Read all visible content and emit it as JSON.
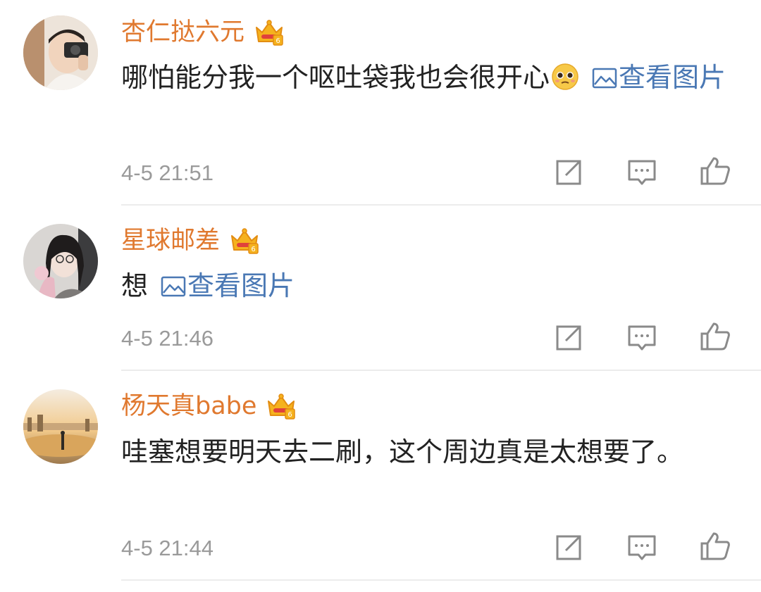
{
  "comments": [
    {
      "username": "杏仁挞六元",
      "text": "哪怕能分我一个呕吐袋我也会很开心",
      "link": "查看图片",
      "time": "4-5 21:51"
    },
    {
      "username": "星球邮差",
      "text": "想",
      "link": "查看图片",
      "time": "4-5 21:46"
    },
    {
      "username": "杨天真babe",
      "text": "哇塞想要明天去二刷，这个周边真是太想要了。",
      "link": "",
      "time": "4-5 21:44"
    }
  ],
  "colors": {
    "username": "#e0792f",
    "link": "#4a78b4",
    "timestamp": "#9a9a9a",
    "divider": "#ececec"
  },
  "icons": [
    "crown-badge-icon",
    "emoji-pleading-icon",
    "image-link-icon",
    "share-icon",
    "comment-icon",
    "like-icon"
  ]
}
